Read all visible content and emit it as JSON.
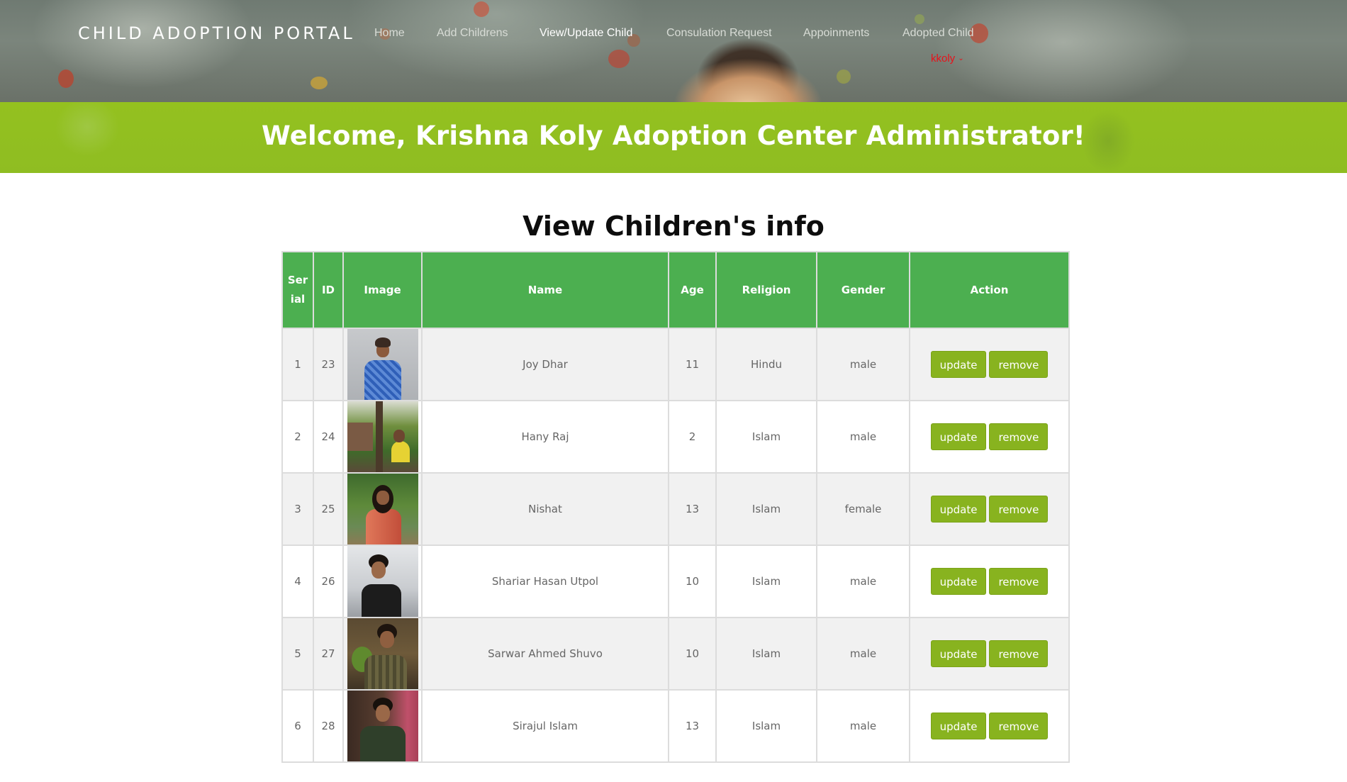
{
  "header": {
    "brand": "CHILD ADOPTION PORTAL",
    "nav": [
      {
        "label": "Home",
        "active": false
      },
      {
        "label": "Add Childrens",
        "active": false
      },
      {
        "label": "View/Update Child",
        "active": true
      },
      {
        "label": "Consulation Request",
        "active": false
      },
      {
        "label": "Appoinments",
        "active": false
      },
      {
        "label": "Adopted Child",
        "active": false
      }
    ],
    "user": "kkoly",
    "user_caret_icon": "chevron-down-icon"
  },
  "banner": {
    "welcome": "Welcome, Krishna Koly Adoption Center Administrator!"
  },
  "main": {
    "title": "View Children's info",
    "table": {
      "headers": {
        "serial": "Serial",
        "id": "ID",
        "image": "Image",
        "name": "Name",
        "age": "Age",
        "religion": "Religion",
        "gender": "Gender",
        "action": "Action"
      },
      "rows": [
        {
          "serial": "1",
          "id": "23",
          "image": "child-photo-23",
          "name": "Joy Dhar",
          "age": "11",
          "religion": "Hindu",
          "gender": "male",
          "update": "update",
          "remove": "remove"
        },
        {
          "serial": "2",
          "id": "24",
          "image": "child-photo-24",
          "name": "Hany Raj",
          "age": "2",
          "religion": "Islam",
          "gender": "male",
          "update": "update",
          "remove": "remove"
        },
        {
          "serial": "3",
          "id": "25",
          "image": "child-photo-25",
          "name": "Nishat",
          "age": "13",
          "religion": "Islam",
          "gender": "female",
          "update": "update",
          "remove": "remove"
        },
        {
          "serial": "4",
          "id": "26",
          "image": "child-photo-26",
          "name": "Shariar Hasan Utpol",
          "age": "10",
          "religion": "Islam",
          "gender": "male",
          "update": "update",
          "remove": "remove"
        },
        {
          "serial": "5",
          "id": "27",
          "image": "child-photo-27",
          "name": "Sarwar Ahmed Shuvo",
          "age": "10",
          "religion": "Islam",
          "gender": "male",
          "update": "update",
          "remove": "remove"
        },
        {
          "serial": "6",
          "id": "28",
          "image": "child-photo-28",
          "name": "Sirajul Islam",
          "age": "13",
          "religion": "Islam",
          "gender": "male",
          "update": "update",
          "remove": "remove"
        }
      ]
    }
  },
  "colors": {
    "banner_green": "#94c11f",
    "table_header_green": "#4caf50",
    "button_green": "#88b31f",
    "user_red": "#e8121b"
  }
}
